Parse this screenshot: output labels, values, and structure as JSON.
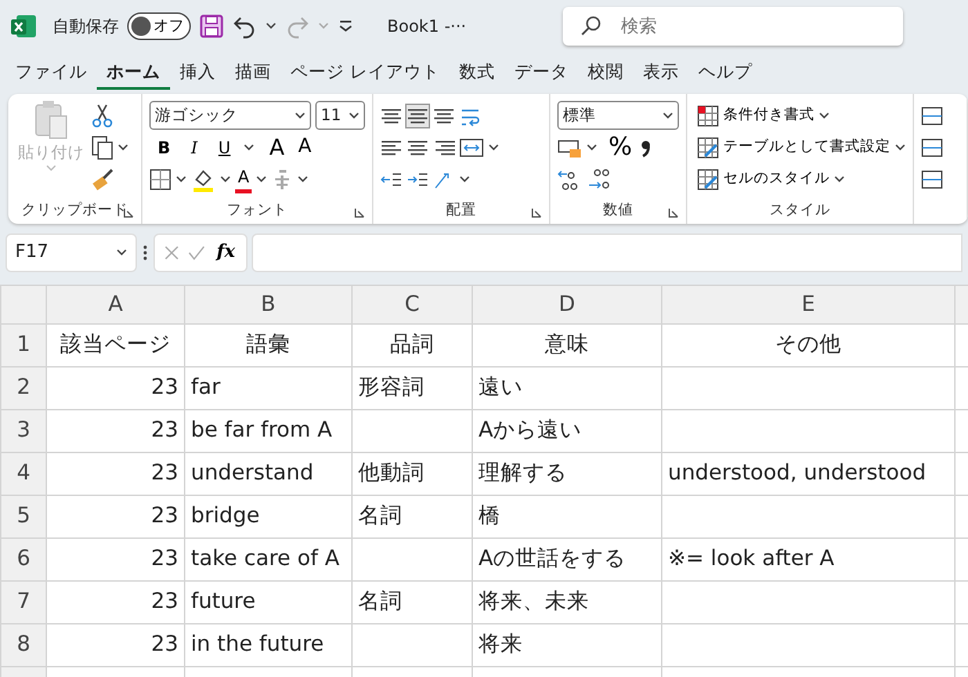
{
  "title_bar": {
    "autosave_label": "自動保存",
    "autosave_toggle": {
      "label": "オフ",
      "on": false
    },
    "document_title": "Book1  -···",
    "search": {
      "placeholder": "検索"
    }
  },
  "menu_tabs": [
    {
      "label": "ファイル",
      "selected": false
    },
    {
      "label": "ホーム",
      "selected": true
    },
    {
      "label": "挿入",
      "selected": false
    },
    {
      "label": "描画",
      "selected": false
    },
    {
      "label": "ページ レイアウト",
      "selected": false
    },
    {
      "label": "数式",
      "selected": false
    },
    {
      "label": "データ",
      "selected": false
    },
    {
      "label": "校閲",
      "selected": false
    },
    {
      "label": "表示",
      "selected": false
    },
    {
      "label": "ヘルプ",
      "selected": false
    }
  ],
  "ribbon": {
    "clipboard": {
      "paste_label": "貼り付け",
      "group_label": "クリップボード"
    },
    "font": {
      "font_name": "游ゴシック",
      "font_size": "11",
      "style_buttons": [
        "B",
        "I",
        "U"
      ],
      "grow_label": "A",
      "shrink_label": "A",
      "font_color_label": "A",
      "group_label": "フォント"
    },
    "alignment": {
      "group_label": "配置"
    },
    "number": {
      "format": "標準",
      "percent_label": "%",
      "group_label": "数値"
    },
    "styles": {
      "items": [
        "条件付き書式",
        "テーブルとして書式設定",
        "セルのスタイル"
      ],
      "group_label": "スタイル"
    }
  },
  "formula_bar": {
    "name_box": "F17",
    "fx_label": "fx"
  },
  "sheet": {
    "columns": [
      "A",
      "B",
      "C",
      "D",
      "E"
    ],
    "rows": [
      {
        "number": "1",
        "cells": [
          "該当ページ",
          "語彙",
          "品詞",
          "意味",
          "その他"
        ]
      },
      {
        "number": "2",
        "cells": [
          "23",
          "far",
          "形容詞",
          "遠い",
          ""
        ]
      },
      {
        "number": "3",
        "cells": [
          "23",
          "be far from A",
          "",
          "Aから遠い",
          ""
        ]
      },
      {
        "number": "4",
        "cells": [
          "23",
          "understand",
          "他動詞",
          "理解する",
          "understood, understood"
        ]
      },
      {
        "number": "5",
        "cells": [
          "23",
          "bridge",
          "名詞",
          "橋",
          ""
        ]
      },
      {
        "number": "6",
        "cells": [
          "23",
          "take care of A",
          "",
          "Aの世話をする",
          "※= look after A"
        ]
      },
      {
        "number": "7",
        "cells": [
          "23",
          "future",
          "名詞",
          "将来、未来",
          ""
        ]
      },
      {
        "number": "8",
        "cells": [
          "23",
          "in the future",
          "",
          "将来",
          ""
        ]
      }
    ]
  }
}
